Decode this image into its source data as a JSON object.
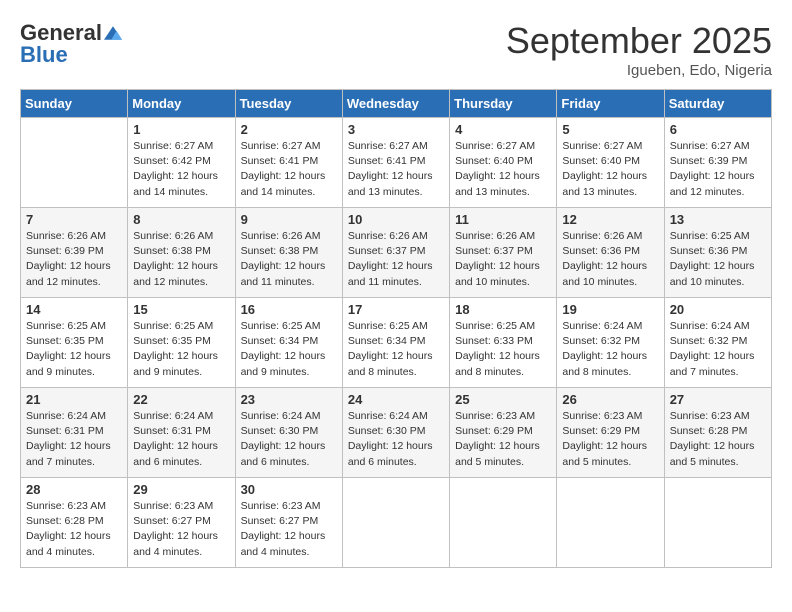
{
  "header": {
    "logo_line1": "General",
    "logo_line2": "Blue",
    "month": "September 2025",
    "location": "Igueben, Edo, Nigeria"
  },
  "weekdays": [
    "Sunday",
    "Monday",
    "Tuesday",
    "Wednesday",
    "Thursday",
    "Friday",
    "Saturday"
  ],
  "weeks": [
    [
      {
        "day": "",
        "info": ""
      },
      {
        "day": "1",
        "info": "Sunrise: 6:27 AM\nSunset: 6:42 PM\nDaylight: 12 hours\nand 14 minutes."
      },
      {
        "day": "2",
        "info": "Sunrise: 6:27 AM\nSunset: 6:41 PM\nDaylight: 12 hours\nand 14 minutes."
      },
      {
        "day": "3",
        "info": "Sunrise: 6:27 AM\nSunset: 6:41 PM\nDaylight: 12 hours\nand 13 minutes."
      },
      {
        "day": "4",
        "info": "Sunrise: 6:27 AM\nSunset: 6:40 PM\nDaylight: 12 hours\nand 13 minutes."
      },
      {
        "day": "5",
        "info": "Sunrise: 6:27 AM\nSunset: 6:40 PM\nDaylight: 12 hours\nand 13 minutes."
      },
      {
        "day": "6",
        "info": "Sunrise: 6:27 AM\nSunset: 6:39 PM\nDaylight: 12 hours\nand 12 minutes."
      }
    ],
    [
      {
        "day": "7",
        "info": "Sunrise: 6:26 AM\nSunset: 6:39 PM\nDaylight: 12 hours\nand 12 minutes."
      },
      {
        "day": "8",
        "info": "Sunrise: 6:26 AM\nSunset: 6:38 PM\nDaylight: 12 hours\nand 12 minutes."
      },
      {
        "day": "9",
        "info": "Sunrise: 6:26 AM\nSunset: 6:38 PM\nDaylight: 12 hours\nand 11 minutes."
      },
      {
        "day": "10",
        "info": "Sunrise: 6:26 AM\nSunset: 6:37 PM\nDaylight: 12 hours\nand 11 minutes."
      },
      {
        "day": "11",
        "info": "Sunrise: 6:26 AM\nSunset: 6:37 PM\nDaylight: 12 hours\nand 10 minutes."
      },
      {
        "day": "12",
        "info": "Sunrise: 6:26 AM\nSunset: 6:36 PM\nDaylight: 12 hours\nand 10 minutes."
      },
      {
        "day": "13",
        "info": "Sunrise: 6:25 AM\nSunset: 6:36 PM\nDaylight: 12 hours\nand 10 minutes."
      }
    ],
    [
      {
        "day": "14",
        "info": "Sunrise: 6:25 AM\nSunset: 6:35 PM\nDaylight: 12 hours\nand 9 minutes."
      },
      {
        "day": "15",
        "info": "Sunrise: 6:25 AM\nSunset: 6:35 PM\nDaylight: 12 hours\nand 9 minutes."
      },
      {
        "day": "16",
        "info": "Sunrise: 6:25 AM\nSunset: 6:34 PM\nDaylight: 12 hours\nand 9 minutes."
      },
      {
        "day": "17",
        "info": "Sunrise: 6:25 AM\nSunset: 6:34 PM\nDaylight: 12 hours\nand 8 minutes."
      },
      {
        "day": "18",
        "info": "Sunrise: 6:25 AM\nSunset: 6:33 PM\nDaylight: 12 hours\nand 8 minutes."
      },
      {
        "day": "19",
        "info": "Sunrise: 6:24 AM\nSunset: 6:32 PM\nDaylight: 12 hours\nand 8 minutes."
      },
      {
        "day": "20",
        "info": "Sunrise: 6:24 AM\nSunset: 6:32 PM\nDaylight: 12 hours\nand 7 minutes."
      }
    ],
    [
      {
        "day": "21",
        "info": "Sunrise: 6:24 AM\nSunset: 6:31 PM\nDaylight: 12 hours\nand 7 minutes."
      },
      {
        "day": "22",
        "info": "Sunrise: 6:24 AM\nSunset: 6:31 PM\nDaylight: 12 hours\nand 6 minutes."
      },
      {
        "day": "23",
        "info": "Sunrise: 6:24 AM\nSunset: 6:30 PM\nDaylight: 12 hours\nand 6 minutes."
      },
      {
        "day": "24",
        "info": "Sunrise: 6:24 AM\nSunset: 6:30 PM\nDaylight: 12 hours\nand 6 minutes."
      },
      {
        "day": "25",
        "info": "Sunrise: 6:23 AM\nSunset: 6:29 PM\nDaylight: 12 hours\nand 5 minutes."
      },
      {
        "day": "26",
        "info": "Sunrise: 6:23 AM\nSunset: 6:29 PM\nDaylight: 12 hours\nand 5 minutes."
      },
      {
        "day": "27",
        "info": "Sunrise: 6:23 AM\nSunset: 6:28 PM\nDaylight: 12 hours\nand 5 minutes."
      }
    ],
    [
      {
        "day": "28",
        "info": "Sunrise: 6:23 AM\nSunset: 6:28 PM\nDaylight: 12 hours\nand 4 minutes."
      },
      {
        "day": "29",
        "info": "Sunrise: 6:23 AM\nSunset: 6:27 PM\nDaylight: 12 hours\nand 4 minutes."
      },
      {
        "day": "30",
        "info": "Sunrise: 6:23 AM\nSunset: 6:27 PM\nDaylight: 12 hours\nand 4 minutes."
      },
      {
        "day": "",
        "info": ""
      },
      {
        "day": "",
        "info": ""
      },
      {
        "day": "",
        "info": ""
      },
      {
        "day": "",
        "info": ""
      }
    ]
  ]
}
